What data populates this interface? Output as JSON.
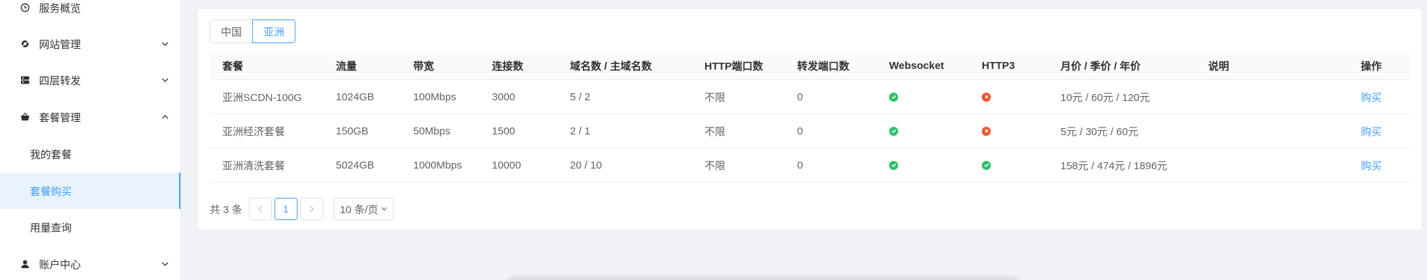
{
  "sidebar": {
    "items": [
      {
        "label": "服务概览",
        "icon": "clock-icon"
      },
      {
        "label": "网站管理",
        "icon": "globe-icon",
        "expanded": false
      },
      {
        "label": "四层转发",
        "icon": "server-icon",
        "expanded": false
      },
      {
        "label": "套餐管理",
        "icon": "basket-icon",
        "expanded": true
      },
      {
        "label": "账户中心",
        "icon": "user-icon",
        "expanded": false
      }
    ],
    "sub_items": [
      {
        "label": "我的套餐"
      },
      {
        "label": "套餐购买",
        "active": true
      },
      {
        "label": "用量查询"
      }
    ]
  },
  "tabs": [
    {
      "label": "中国",
      "active": false
    },
    {
      "label": "亚洲",
      "active": true
    }
  ],
  "table": {
    "headers": [
      "套餐",
      "流量",
      "带宽",
      "连接数",
      "域名数 / 主域名数",
      "HTTP端口数",
      "转发端口数",
      "Websocket",
      "HTTP3",
      "月价 / 季价 / 年价",
      "说明",
      "操作"
    ],
    "rows": [
      {
        "name": "亚洲SCDN-100G",
        "traffic": "1024GB",
        "bandwidth": "100Mbps",
        "connections": "3000",
        "domains": "5 / 2",
        "http_ports": "不限",
        "forward_ports": "0",
        "websocket": true,
        "http3": false,
        "price": "10元 / 60元 / 120元",
        "desc": "",
        "action": "购买"
      },
      {
        "name": "亚洲经济套餐",
        "traffic": "150GB",
        "bandwidth": "50Mbps",
        "connections": "1500",
        "domains": "2 / 1",
        "http_ports": "不限",
        "forward_ports": "0",
        "websocket": true,
        "http3": false,
        "price": "5元 / 30元 / 60元",
        "desc": "",
        "action": "购买"
      },
      {
        "name": "亚洲清洗套餐",
        "traffic": "5024GB",
        "bandwidth": "1000Mbps",
        "connections": "10000",
        "domains": "20 / 10",
        "http_ports": "不限",
        "forward_ports": "0",
        "websocket": true,
        "http3": true,
        "price": "158元 / 474元 / 1896元",
        "desc": "",
        "action": "购买"
      }
    ]
  },
  "pagination": {
    "total_text": "共 3 条",
    "current_page": "1",
    "page_size": "10 条/页"
  },
  "colors": {
    "accent": "#409eff",
    "ok": "#2ec26a",
    "no": "#f0562d"
  }
}
